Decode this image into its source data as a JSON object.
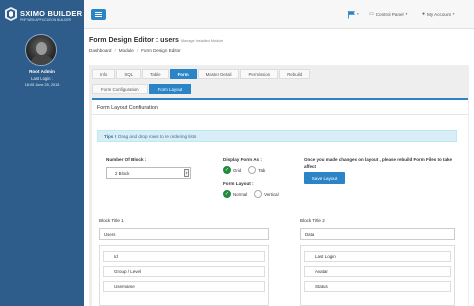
{
  "brand": {
    "name": "SXIMO BUILDER",
    "tagline": "PHP WEB APPLICATION BUILDER"
  },
  "topnav": {
    "control_panel": "Control Panel",
    "account": "My Account"
  },
  "sidebar": {
    "user_name": "Root Admin",
    "last_login_label": "Last Login :",
    "last_login_time": "18:05 June 25, 2015"
  },
  "page": {
    "title": "Form Design Editor : users",
    "subtitle": "Manage Installed Module"
  },
  "breadcrumb": [
    "Dashboard",
    "Module",
    "Form Design Editor"
  ],
  "tabs": [
    {
      "label": "Info",
      "active": false
    },
    {
      "label": "SQL",
      "active": false
    },
    {
      "label": "Table",
      "active": false
    },
    {
      "label": "Form",
      "active": true
    },
    {
      "label": "Master Detail",
      "active": false
    },
    {
      "label": "Permission",
      "active": false
    },
    {
      "label": "Rebuild",
      "active": false
    }
  ],
  "subtabs": [
    {
      "label": "Form Configuration",
      "active": false
    },
    {
      "label": "Form Layout",
      "active": true
    }
  ],
  "card": {
    "title": "Form Layout Confiuration",
    "tips_label": "Tips !",
    "tips_text": "Drag and drop rows to re ordering lists"
  },
  "form": {
    "block_label": "Number Of Block :",
    "block_value": "2 Block",
    "display_label": "Display Form As :",
    "display_options": [
      "Grid",
      "Tab"
    ],
    "display_selected": "Grid",
    "layout_label": "Form Layout :",
    "layout_options": [
      "Normal",
      "Vertical"
    ],
    "layout_selected": "Normal",
    "note": "Once you made changes on layout , please rebuild Form Files to take affect",
    "save_label": "Save Layout"
  },
  "blocks": [
    {
      "title": "Block Title 1",
      "value": "Users",
      "items": [
        "Id",
        "Group / Level",
        "Username"
      ]
    },
    {
      "title": "Block Title 2",
      "value": "Data",
      "items": [
        "Last Login",
        "Avatar",
        "Status"
      ]
    }
  ],
  "colors": {
    "sidebar": "#2e5d8c",
    "accent": "#2a84c6",
    "success": "#1f8a3b"
  }
}
